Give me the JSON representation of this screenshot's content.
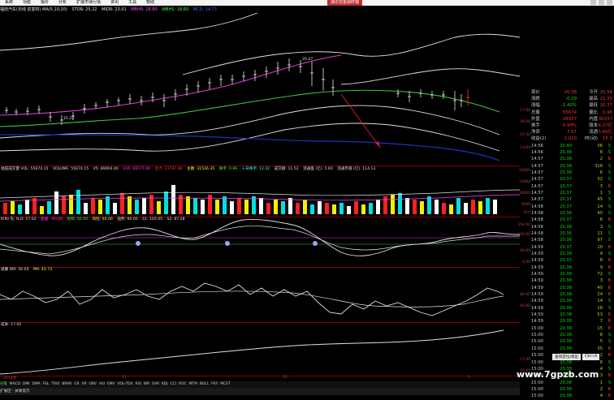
{
  "menubar": {
    "items": [
      "系统",
      "功能",
      "报价",
      "分析",
      "扩展市场行情",
      "资讯",
      "工具",
      "帮助"
    ],
    "tag": "通达信金融终端"
  },
  "title": {
    "name": "福田汽车(日线 前复权) MA(5,10,20)",
    "stor": "STOR: 25.22",
    "midr": "MIDR: 23.01",
    "mbhr": "MBHR: 28.80",
    "wbhs": "WBHS: 18.60",
    "mcd": "MCD: 14.73"
  },
  "main_axis": [
    "20.00",
    "19.00",
    "18.00",
    "17.00",
    "16.00",
    "15.00",
    "14.00"
  ],
  "annotations": {
    "high": "20.47",
    "low": "15.22"
  },
  "volume": {
    "label": "福田成交量 VOL: 55674.15",
    "volume": "VOLUME: 55674.15",
    "v5": "V5: 89004.40",
    "v10": "V10: 69577.60",
    "v20": "主力: 23747.60",
    "v_extra": "主散: 31526.35",
    "ratio": "换手: 0.99",
    "turn": "十日换手: 12.42",
    "amount": "成交额: 11.52",
    "cap": "流通盘 (亿): 5.60",
    "market": "流通市值 (亿): 114.13",
    "axis": [
      "20000",
      "15000",
      "10000",
      "5000",
      "X10"
    ]
  },
  "kdj": {
    "label": "K(N) 先: N,D: 57.62",
    "p1": "超级: -60.00",
    "p2": "指标: 60.00",
    "p3": "风险: 60.00",
    "p4": "强势: 60.00",
    "p5": "S1: 105.05",
    "p6": "S2: 87.28",
    "axis": [
      "150.00",
      "100.00",
      "60.00",
      "0.00"
    ]
  },
  "wr": {
    "label": "威廉 WR: 56.04",
    "ma": "MA: 42.73",
    "axis": [
      "80.00",
      "60.00"
    ]
  },
  "bottom": {
    "label": "成本: 17.92",
    "axis": [
      "17.00",
      "16.00"
    ]
  },
  "quote": {
    "rows": [
      {
        "a": "现价",
        "b": "20.38",
        "c": "今开",
        "d": "20.58"
      },
      {
        "a": "涨跌",
        "b": "-0.29",
        "c": "最高",
        "d": "21.35"
      },
      {
        "a": "涨幅",
        "b": "-1.40%",
        "c": "最低",
        "d": "20.37"
      },
      {
        "a": "总量",
        "b": "55674",
        "c": "量比",
        "d": "0.96"
      },
      {
        "a": "外盘",
        "b": "29337",
        "c": "内盘",
        "d": "30337"
      },
      {
        "a": "换手",
        "b": "0.99%",
        "c": "股本",
        "d": "6.27亿"
      },
      {
        "a": "净资",
        "b": "7.57",
        "c": "流通",
        "d": "5.60亿"
      },
      {
        "a": "收益(2)",
        "b": "1.020",
        "c": "PE(动)",
        "d": "15.3"
      }
    ],
    "ticks": [
      {
        "t": "14:56",
        "p": "20.40",
        "v": "36",
        "s": "S"
      },
      {
        "t": "14:56",
        "p": "20.38",
        "v": "8",
        "s": "S"
      },
      {
        "t": "14:57",
        "p": "20.38",
        "v": "2",
        "s": "B"
      },
      {
        "t": "14:57",
        "p": "20.38",
        "v": "316",
        "s": "S"
      },
      {
        "t": "14:57",
        "p": "20.38",
        "v": "6",
        "s": "S"
      },
      {
        "t": "14:57",
        "p": "20.37",
        "v": "32",
        "s": "S"
      },
      {
        "t": "14:57",
        "p": "20.37",
        "v": "3",
        "s": "B"
      },
      {
        "t": "14:57",
        "p": "20.37",
        "v": "1",
        "s": "S"
      },
      {
        "t": "14:57",
        "p": "20.37",
        "v": "45",
        "s": "S"
      },
      {
        "t": "14:58",
        "p": "20.37",
        "v": "14",
        "s": "S"
      },
      {
        "t": "14:58",
        "p": "20.36",
        "v": "45",
        "s": "S"
      },
      {
        "t": "14:58",
        "p": "20.37",
        "v": "6",
        "s": "B"
      },
      {
        "t": "14:58",
        "p": "20.36",
        "v": "3",
        "s": "S"
      },
      {
        "t": "14:58",
        "p": "20.36",
        "v": "11",
        "s": "S"
      },
      {
        "t": "14:58",
        "p": "20.36",
        "v": "97",
        "s": "S"
      },
      {
        "t": "14:59",
        "p": "20.37",
        "v": "10",
        "s": "B"
      },
      {
        "t": "14:59",
        "p": "20.38",
        "v": "4",
        "s": "S"
      },
      {
        "t": "14:59",
        "p": "20.37",
        "v": "8",
        "s": "B"
      },
      {
        "t": "14:59",
        "p": "20.38",
        "v": "9",
        "s": "B"
      },
      {
        "t": "14:59",
        "p": "20.38",
        "v": "72",
        "s": "S"
      },
      {
        "t": "14:59",
        "p": "20.38",
        "v": "3",
        "s": "B"
      },
      {
        "t": "14:59",
        "p": "20.38",
        "v": "40",
        "s": "B"
      },
      {
        "t": "14:59",
        "p": "20.38",
        "v": "24",
        "s": "B"
      },
      {
        "t": "14:59",
        "p": "20.38",
        "v": "14",
        "s": "S"
      },
      {
        "t": "14:59",
        "p": "20.38",
        "v": "18",
        "s": "S"
      },
      {
        "t": "14:59",
        "p": "20.38",
        "v": "53",
        "s": "B"
      },
      {
        "t": "14:59",
        "p": "20.38",
        "v": "7",
        "s": "B"
      },
      {
        "t": "15:00",
        "p": "20.38",
        "v": "15",
        "s": "B"
      },
      {
        "t": "15:00",
        "p": "20.38",
        "v": "8",
        "s": "S"
      },
      {
        "t": "15:00",
        "p": "20.38",
        "v": "5",
        "s": "S"
      },
      {
        "t": "15:00",
        "p": "20.38",
        "v": "35",
        "s": "B"
      },
      {
        "t": "15:00",
        "p": "20.38",
        "v": "2",
        "s": "B"
      },
      {
        "t": "15:00",
        "p": "20.38",
        "v": "6",
        "s": "S"
      },
      {
        "t": "15:00",
        "p": "20.38",
        "v": "4",
        "s": "S"
      },
      {
        "t": "15:00",
        "p": "20.38",
        "v": "3",
        "s": "B"
      },
      {
        "t": "15:00",
        "p": "20.38",
        "v": "1",
        "s": "S"
      },
      {
        "t": "15:00",
        "p": "20.38",
        "v": "2",
        "s": "B"
      },
      {
        "t": "15:00",
        "p": "20.38",
        "v": "4",
        "s": "B"
      }
    ]
  },
  "popup": {
    "left": "查找定位/调出",
    "right": "Ctrl+A"
  },
  "time_axis": {
    "t1": "2014年",
    "t2": "11",
    "t3": "12",
    "t4": "2"
  },
  "toolbar": [
    "分笔",
    "MACD",
    "DMI",
    "DMA",
    "FSL",
    "TRIX",
    "BRAR",
    "CR",
    "VR",
    "OBV",
    "ASI",
    "EMV",
    "VOL-TDX",
    "RSI",
    "WR",
    "SAR",
    "KDJ",
    "CCI",
    "ROC",
    "MTM",
    "BOLL",
    "PSY",
    "MCST"
  ],
  "status": "扩展区 · 关联提示",
  "watermark": "www.7gpzb.com",
  "colors": {
    "up": "#ff2020",
    "down": "#00e0e0",
    "yellow": "#f0f000",
    "grid": "#800000"
  }
}
